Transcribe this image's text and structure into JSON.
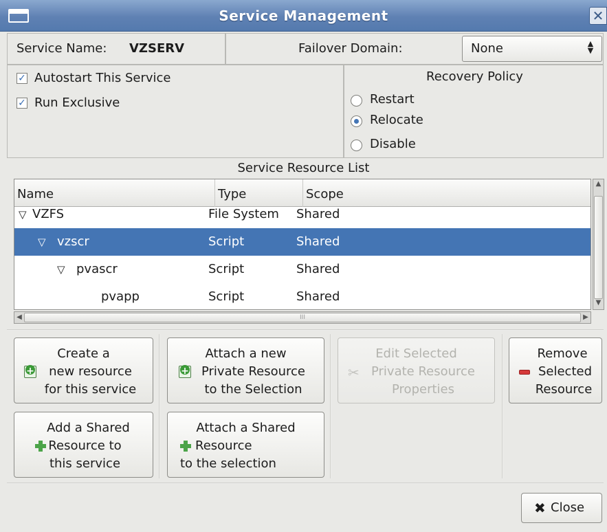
{
  "window": {
    "title": "Service Management",
    "close_glyph": "✕"
  },
  "service": {
    "name_label": "Service Name:",
    "name_value": "VZSERV",
    "failover_label": "Failover Domain:",
    "failover_value": "None",
    "combo_arrows": "▲▼"
  },
  "options": {
    "autostart_label": "Autostart This Service",
    "autostart_checked": true,
    "exclusive_label": "Run Exclusive",
    "exclusive_checked": true
  },
  "recovery": {
    "title": "Recovery Policy",
    "options": [
      {
        "label": "Restart",
        "selected": false
      },
      {
        "label": "Relocate",
        "selected": true
      },
      {
        "label": "Disable",
        "selected": false
      }
    ]
  },
  "resources": {
    "title": "Service Resource List",
    "columns": [
      "Name",
      "Type",
      "Scope"
    ],
    "rows": [
      {
        "expander": "▽",
        "name": "VZFS",
        "type": "File System",
        "scope": "Shared",
        "selected": false
      },
      {
        "expander": "▽",
        "name": "vzscr",
        "type": "Script",
        "scope": "Shared",
        "selected": true
      },
      {
        "expander": "▽",
        "name": "pvascr",
        "type": "Script",
        "scope": "Shared",
        "selected": false
      },
      {
        "expander": "",
        "name": "pvapp",
        "type": "Script",
        "scope": "Shared",
        "selected": false
      }
    ],
    "hscroll_grip": "III"
  },
  "actions": {
    "create_new": [
      "Create a",
      "new resource",
      "for this service"
    ],
    "attach_private": [
      "Attach a new",
      "Private Resource",
      "to the Selection"
    ],
    "edit_selected": [
      "Edit Selected",
      "Private Resource",
      "Properties"
    ],
    "remove_selected": [
      "Remove",
      "Selected",
      "Resource"
    ],
    "add_shared": [
      "Add a Shared",
      "Resource to",
      "this service"
    ],
    "attach_shared": [
      "Attach a Shared",
      "Resource",
      "to the selection"
    ]
  },
  "footer": {
    "close_label": "Close",
    "close_icon": "✖"
  },
  "colors": {
    "selection": "#4475b4",
    "titlebar": "#5f81b3"
  }
}
